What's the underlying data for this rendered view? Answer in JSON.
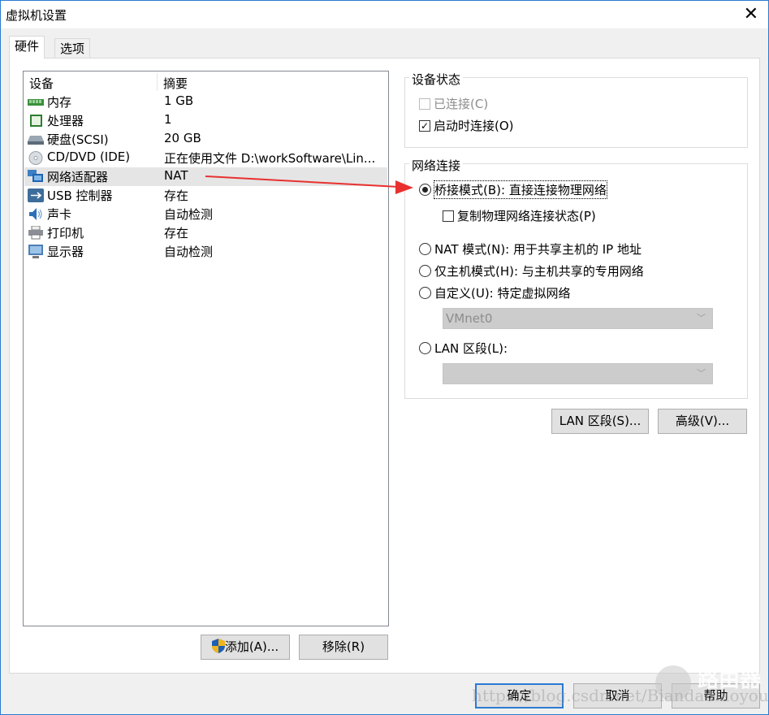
{
  "window": {
    "title": "虚拟机设置",
    "close_icon": "close-icon"
  },
  "tabs": [
    {
      "label": "硬件",
      "active": true
    },
    {
      "label": "选项",
      "active": false
    }
  ],
  "device_list": {
    "headers": {
      "device": "设备",
      "summary": "摘要"
    },
    "items": [
      {
        "icon": "memory-icon",
        "name": "内存",
        "summary": "1 GB"
      },
      {
        "icon": "processor-icon",
        "name": "处理器",
        "summary": "1"
      },
      {
        "icon": "hard-disk-icon",
        "name": "硬盘(SCSI)",
        "summary": "20 GB"
      },
      {
        "icon": "cd-dvd-icon",
        "name": "CD/DVD (IDE)",
        "summary": "正在使用文件 D:\\workSoftware\\Lin..."
      },
      {
        "icon": "network-adapter-icon",
        "name": "网络适配器",
        "summary": "NAT",
        "selected": true
      },
      {
        "icon": "usb-icon",
        "name": "USB 控制器",
        "summary": "存在"
      },
      {
        "icon": "sound-card-icon",
        "name": "声卡",
        "summary": "自动检测"
      },
      {
        "icon": "printer-icon",
        "name": "打印机",
        "summary": "存在"
      },
      {
        "icon": "display-icon",
        "name": "显示器",
        "summary": "自动检测"
      }
    ]
  },
  "device_buttons": {
    "add": "添加(A)...",
    "remove": "移除(R)"
  },
  "device_status": {
    "label": "设备状态",
    "connected": {
      "label": "已连接(C)",
      "checked": false,
      "disabled": true
    },
    "connect_on_start": {
      "label": "启动时连接(O)",
      "checked": true
    }
  },
  "network": {
    "label": "网络连接",
    "options": [
      {
        "label": "桥接模式(B): 直接连接物理网络",
        "selected": true
      },
      {
        "label": "NAT 模式(N): 用于共享主机的 IP 地址",
        "selected": false
      },
      {
        "label": "仅主机模式(H): 与主机共享的专用网络",
        "selected": false
      },
      {
        "label": "自定义(U): 特定虚拟网络",
        "selected": false
      },
      {
        "label": "LAN 区段(L):",
        "selected": false
      }
    ],
    "replicate": {
      "label": "复制物理网络连接状态(P)",
      "checked": false
    },
    "custom_select_value": "VMnet0",
    "lan_select_value": ""
  },
  "net_buttons": {
    "lan_segments": "LAN 区段(S)...",
    "advanced": "高级(V)..."
  },
  "footer": {
    "ok": "确定",
    "cancel": "取消",
    "help": "帮助"
  },
  "annotation": {
    "arrow_color": "#e8312f"
  },
  "watermark": {
    "url": "https://blog.csdn.net/Biandanlaoyou",
    "brand": "路由器"
  }
}
